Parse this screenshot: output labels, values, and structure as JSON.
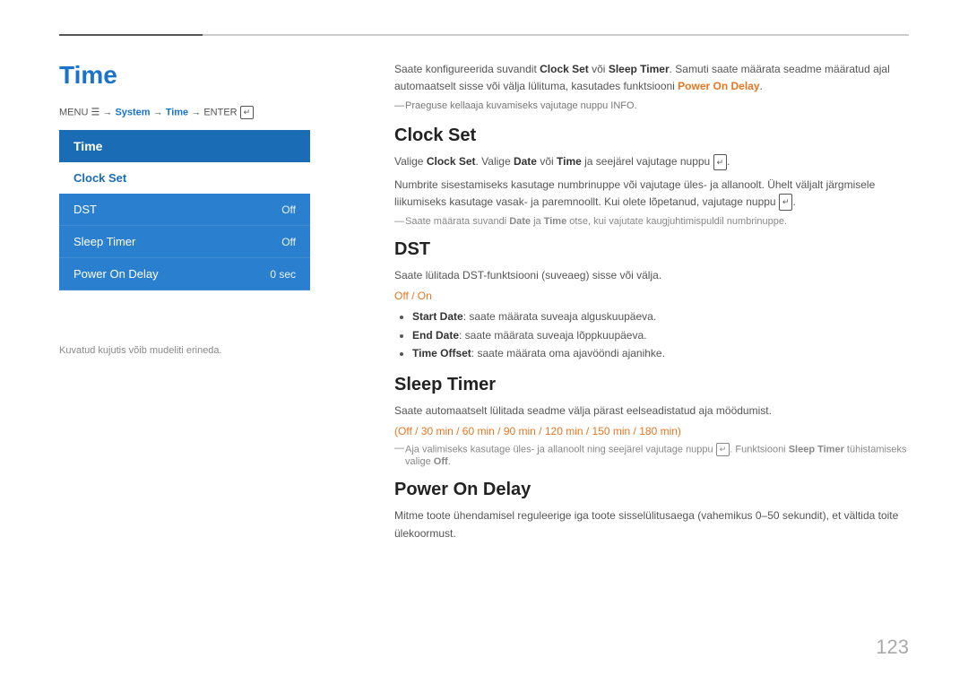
{
  "topbar": {},
  "page": {
    "title": "Time",
    "menu_path": "MENU",
    "menu_system": "System",
    "menu_time": "Time",
    "menu_enter": "ENTER"
  },
  "sidebar": {
    "header": "Time",
    "items": [
      {
        "label": "Clock Set",
        "value": "",
        "active": true
      },
      {
        "label": "DST",
        "value": "Off",
        "active": false
      },
      {
        "label": "Sleep Timer",
        "value": "Off",
        "active": false
      },
      {
        "label": "Power On Delay",
        "value": "0 sec",
        "active": false
      }
    ],
    "note": "Kuvatud kujutis võib mudeliti erineda."
  },
  "content": {
    "intro": {
      "text": "Saate konfigureerida suvandit Clock Set või Sleep Timer. Samuti saate määrata seadme määratud ajal automaatselt sisse või välja lülituma, kasutades funktsiooni Power On Delay.",
      "note": "Praeguse kellaaja kuvamiseks vajutage nuppu INFO."
    },
    "clock_set": {
      "title": "Clock Set",
      "text1": "Valige Clock Set. Valige Date või Time ja seejärel vajutage nuppu",
      "text2": "Numbrite sisestamiseks kasutage numbrinuppe või vajutage üles- ja allanoolt. Ühelt väljalt järgmisele liikumiseks kasutage vasak- ja paremnoollt. Kui olete lõpetanud, vajutage nuppu",
      "note": "Saate määrata suvandi Date ja Time otse, kui vajutate kaugjuhtimispuldil numbrinuppe."
    },
    "dst": {
      "title": "DST",
      "text": "Saate lülitada DST-funktsiooni (suveaeg) sisse või välja.",
      "options": "Off / On",
      "bullets": [
        {
          "label": "Start Date",
          "text": ": saate määrata suveaja alguskuupäeva."
        },
        {
          "label": "End Date",
          "text": ": saate määrata suveaja lõppkuupäeva."
        },
        {
          "label": "Time Offset",
          "text": ": saate määrata oma ajvööndi ajanihke."
        }
      ]
    },
    "sleep_timer": {
      "title": "Sleep Timer",
      "text": "Saate automaatselt lülitada seadme välja pärast eelseadistatud aja möödumist.",
      "options": "(Off / 30 min / 60 min / 90 min / 120 min / 150 min / 180 min)",
      "note1": "Aja valimiseks kasutage üles- ja allanoolt ning seejärel vajutage nuppu",
      "note2": ". Funktsiooni Sleep Timer tühistamiseks valige Off."
    },
    "power_on_delay": {
      "title": "Power On Delay",
      "text": "Mitme toote ühendamisel reguleerige iga toote sisselülitusaega (vahemikus 0–50 sekundit), et vältida toite ülekoormust."
    }
  },
  "page_number": "123"
}
